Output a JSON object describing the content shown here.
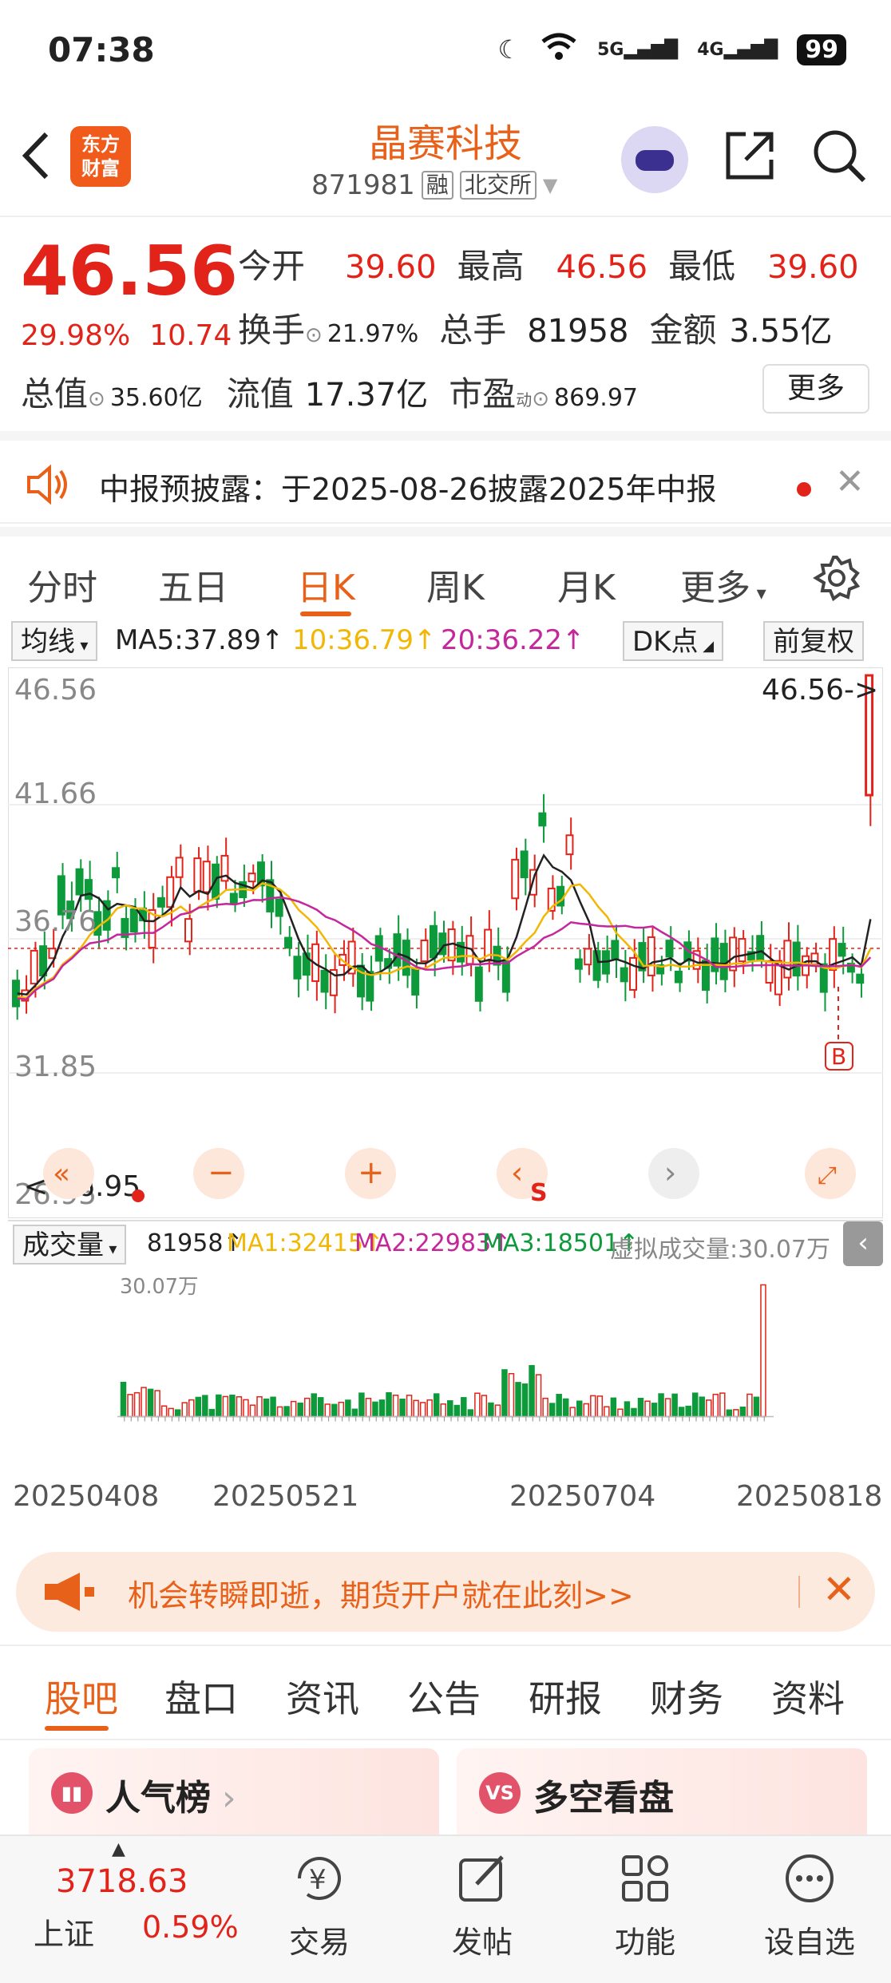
{
  "status_bar": {
    "time": "07:38",
    "network1": "5G",
    "network2": "4G",
    "battery": "99"
  },
  "header": {
    "logo_text_line1": "东方",
    "logo_text_line2": "财富",
    "stock_name": "晶赛科技",
    "stock_code": "871981",
    "tag_rong": "融",
    "exchange": "北交所"
  },
  "quote": {
    "price": "46.56",
    "change_pct": "29.98%",
    "change": "10.74",
    "open_label": "今开",
    "open": "39.60",
    "high_label": "最高",
    "high": "46.56",
    "low_label": "最低",
    "low": "39.60",
    "turnover_label": "换手",
    "turnover": "21.97%",
    "volume_label": "总手",
    "volume": "81958",
    "amount_label": "金额",
    "amount": "3.55亿",
    "mktcap_label": "总值",
    "mktcap": "35.60亿",
    "float_label": "流值",
    "float": "17.37亿",
    "pe_label": "市盈",
    "pe_sup": "动",
    "pe": "869.97",
    "more_label": "更多"
  },
  "notice": {
    "text": "中报预披露：于2025-08-26披露2025年中报"
  },
  "chart_tabs": {
    "items": [
      "分时",
      "五日",
      "日K",
      "周K",
      "月K",
      "更多"
    ],
    "active": "日K"
  },
  "ma_legend": {
    "selector": "均线",
    "ma5": "MA5:37.89↑",
    "ma10": "10:36.79↑",
    "ma20": "20:36.22↑",
    "dk_label": "DK点",
    "adjust_label": "前复权"
  },
  "kline": {
    "y_labels": [
      "46.56",
      "41.66",
      "36.76",
      "31.85",
      "26.95"
    ],
    "last_price_label": "46.56->",
    "low_marker_label": "<-26.95",
    "buy_marker": "B",
    "sell_marker": "S"
  },
  "volume_legend": {
    "selector": "成交量",
    "vol": "81958↑",
    "ma1": "MA1:32415↑",
    "ma2": "MA2:22983↑",
    "ma3": "MA3:18501↑",
    "virtual": "虚拟成交量:30.07万",
    "y_max": "30.07万"
  },
  "x_dates": [
    "20250408",
    "20250521",
    "20250704",
    "20250818"
  ],
  "colors": {
    "up": "#e2231a",
    "down": "#0c9a3a",
    "accent": "#e8611a",
    "ma5": "#222222",
    "ma10": "#f2b705",
    "ma20": "#c4279b"
  },
  "promo": {
    "text": "机会转瞬即逝，期货开户就在此刻>>"
  },
  "content_tabs": {
    "items": [
      "股吧",
      "盘口",
      "资讯",
      "公告",
      "研报",
      "财务",
      "资料"
    ],
    "active": "股吧"
  },
  "cards": {
    "rank_title": "人气榜",
    "duokong_title": "多空看盘",
    "duokong_icon": "VS"
  },
  "bottom_nav": {
    "index_value": "3718.63",
    "index_name": "上证",
    "index_pct": "0.59%",
    "items": [
      "交易",
      "发帖",
      "功能",
      "设自选"
    ]
  }
}
